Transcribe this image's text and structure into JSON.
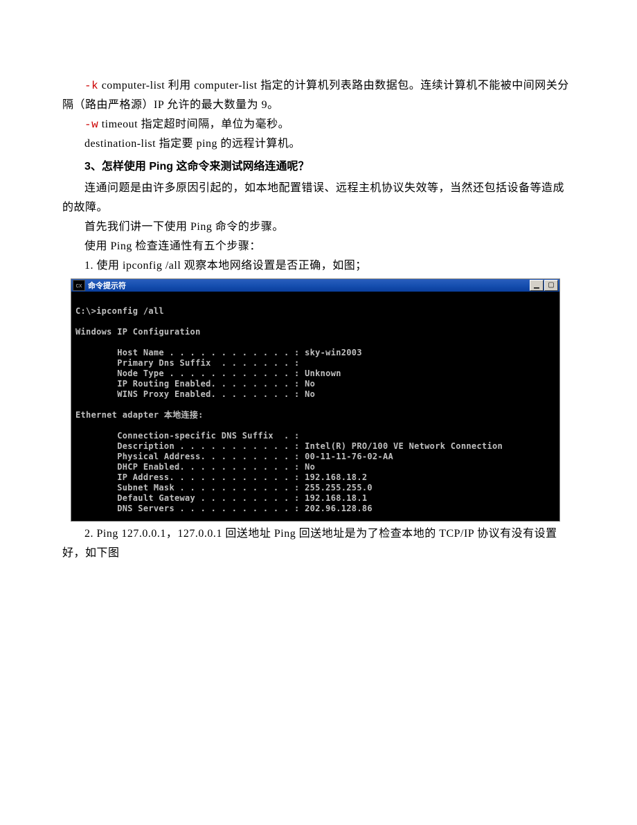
{
  "paragraphs": {
    "p1_flag": "-k",
    "p1_text": " computer-list 利用 computer-list 指定的计算机列表路由数据包。连续计算机不能被中间网关分隔（路由严格源）IP 允许的最大数量为 9。",
    "p2_flag": "-w",
    "p2_text": " timeout 指定超时间隔，单位为毫秒。",
    "p3": "destination-list 指定要 ping 的远程计算机。",
    "h3": "3、怎样使用 Ping 这命令来测试网络连通呢？",
    "p4": "连通问题是由许多原因引起的，如本地配置错误、远程主机协议失效等，当然还包括设备等造成的故障。",
    "p5": "首先我们讲一下使用 Ping 命令的步骤。",
    "p6": "使用 Ping 检查连通性有五个步骤：",
    "p7": "1. 使用 ipconfig /all 观察本地网络设置是否正确，如图；",
    "p8": "2. Ping 127.0.0.1，127.0.0.1 回送地址 Ping 回送地址是为了检查本地的 TCP/IP 协议有没有设置好，如下图"
  },
  "terminal": {
    "icon_text": "cx",
    "title": "命令提示符",
    "lines": [
      "",
      "C:\\>ipconfig /all",
      "",
      "Windows IP Configuration",
      "",
      "        Host Name . . . . . . . . . . . . : sky-win2003",
      "        Primary Dns Suffix  . . . . . . . :",
      "        Node Type . . . . . . . . . . . . : Unknown",
      "        IP Routing Enabled. . . . . . . . : No",
      "        WINS Proxy Enabled. . . . . . . . : No",
      "",
      "Ethernet adapter 本地连接:",
      "",
      "        Connection-specific DNS Suffix  . :",
      "        Description . . . . . . . . . . . : Intel(R) PRO/100 VE Network Connection",
      "        Physical Address. . . . . . . . . : 00-11-11-76-02-AA",
      "        DHCP Enabled. . . . . . . . . . . : No",
      "        IP Address. . . . . . . . . . . . : 192.168.18.2",
      "        Subnet Mask . . . . . . . . . . . : 255.255.255.0",
      "        Default Gateway . . . . . . . . . : 192.168.18.1",
      "        DNS Servers . . . . . . . . . . . : 202.96.128.86"
    ]
  }
}
